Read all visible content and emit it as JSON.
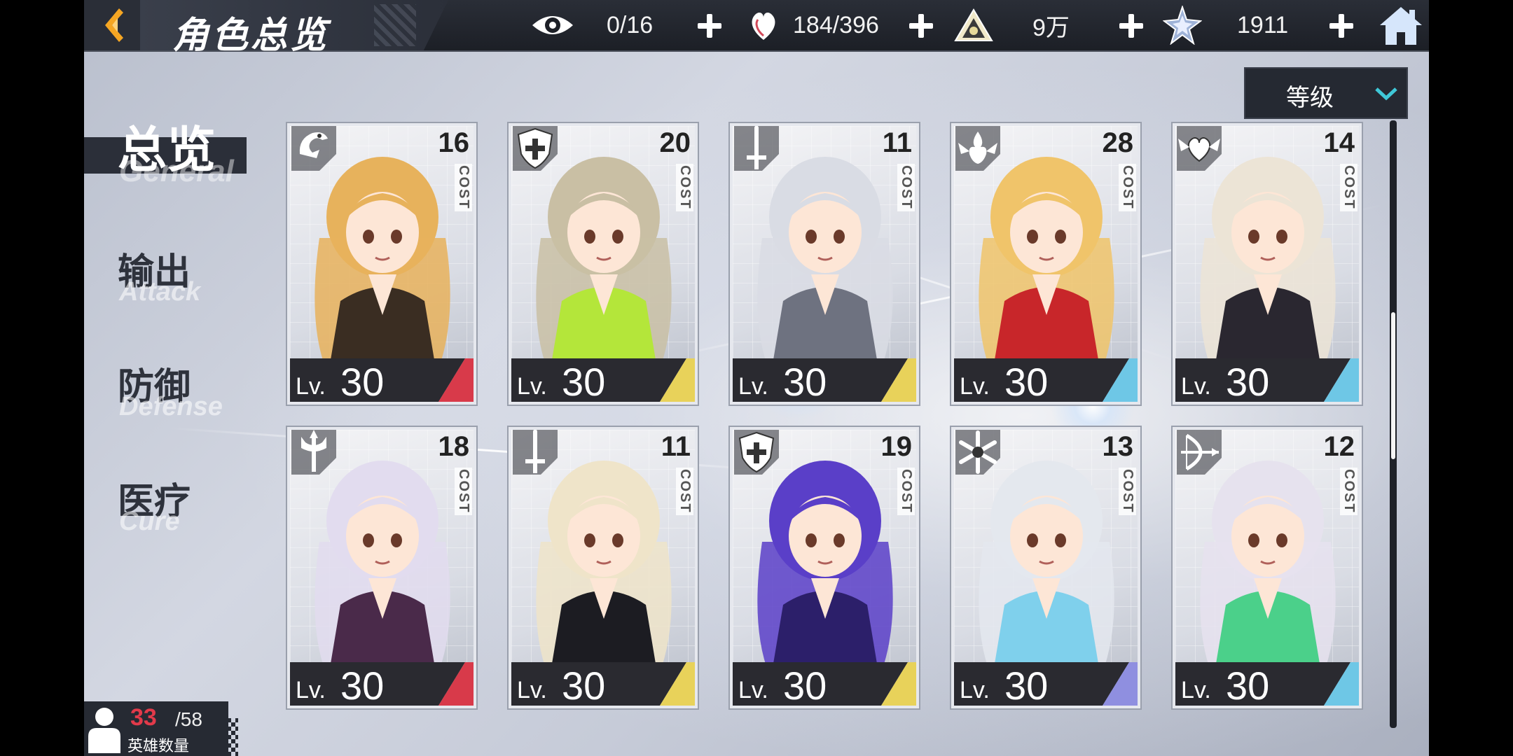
{
  "header": {
    "title": "角色总览",
    "resources": [
      {
        "icon": "eye-icon",
        "value": "0/16"
      },
      {
        "icon": "heart-potion-icon",
        "value": "184/396"
      },
      {
        "icon": "gold-coin-icon",
        "value": "9万"
      },
      {
        "icon": "crystal-star-icon",
        "value": "1911"
      }
    ]
  },
  "sort": {
    "label": "等级"
  },
  "nav": {
    "active": {
      "zh": "总览",
      "en": "General"
    },
    "items": [
      {
        "zh": "输出",
        "en": "Attack"
      },
      {
        "zh": "防御",
        "en": "Defense"
      },
      {
        "zh": "医疗",
        "en": "Cure"
      }
    ]
  },
  "cards": [
    {
      "cost": "16",
      "cost_label": "COST",
      "lv_label": "Lv.",
      "level": "30",
      "class_icon": "dragon-icon",
      "rarity_color": "#d83a4a",
      "hair": "#e7b25c",
      "outfit": "#3a2d22"
    },
    {
      "cost": "20",
      "cost_label": "COST",
      "lv_label": "Lv.",
      "level": "30",
      "class_icon": "shield-cross-icon",
      "rarity_color": "#e8d25a",
      "hair": "#c9bfa4",
      "outfit": "#b4e63a"
    },
    {
      "cost": "11",
      "cost_label": "COST",
      "lv_label": "Lv.",
      "level": "30",
      "class_icon": "sword-icon",
      "rarity_color": "#e8d25a",
      "hair": "#d9dce4",
      "outfit": "#6e7280"
    },
    {
      "cost": "28",
      "cost_label": "COST",
      "lv_label": "Lv.",
      "level": "30",
      "class_icon": "flame-wing-icon",
      "rarity_color": "#6ec7e6",
      "hair": "#f0c46a",
      "outfit": "#c8262a"
    },
    {
      "cost": "14",
      "cost_label": "COST",
      "lv_label": "Lv.",
      "level": "30",
      "class_icon": "heart-wing-icon",
      "rarity_color": "#6ec7e6",
      "hair": "#ece4d6",
      "outfit": "#2a2730"
    },
    {
      "cost": "18",
      "cost_label": "COST",
      "lv_label": "Lv.",
      "level": "30",
      "class_icon": "trident-icon",
      "rarity_color": "#d83a4a",
      "hair": "#e2dcef",
      "outfit": "#4a2a4a"
    },
    {
      "cost": "11",
      "cost_label": "COST",
      "lv_label": "Lv.",
      "level": "30",
      "class_icon": "sword-icon",
      "rarity_color": "#e8d25a",
      "hair": "#efe4c9",
      "outfit": "#1c1c22"
    },
    {
      "cost": "19",
      "cost_label": "COST",
      "lv_label": "Lv.",
      "level": "30",
      "class_icon": "shield-cross-icon",
      "rarity_color": "#e8d25a",
      "hair": "#5a3fc8",
      "outfit": "#2c1f6a"
    },
    {
      "cost": "13",
      "cost_label": "COST",
      "lv_label": "Lv.",
      "level": "30",
      "class_icon": "snowflake-icon",
      "rarity_color": "#8f8fe0",
      "hair": "#e4e8ee",
      "outfit": "#7fd0ec"
    },
    {
      "cost": "12",
      "cost_label": "COST",
      "lv_label": "Lv.",
      "level": "30",
      "class_icon": "bow-icon",
      "rarity_color": "#6ec7e6",
      "hair": "#e6e2ee",
      "outfit": "#4bd08a"
    }
  ],
  "hero_count": {
    "current": "33",
    "max": "/58",
    "label": "英雄数量"
  }
}
